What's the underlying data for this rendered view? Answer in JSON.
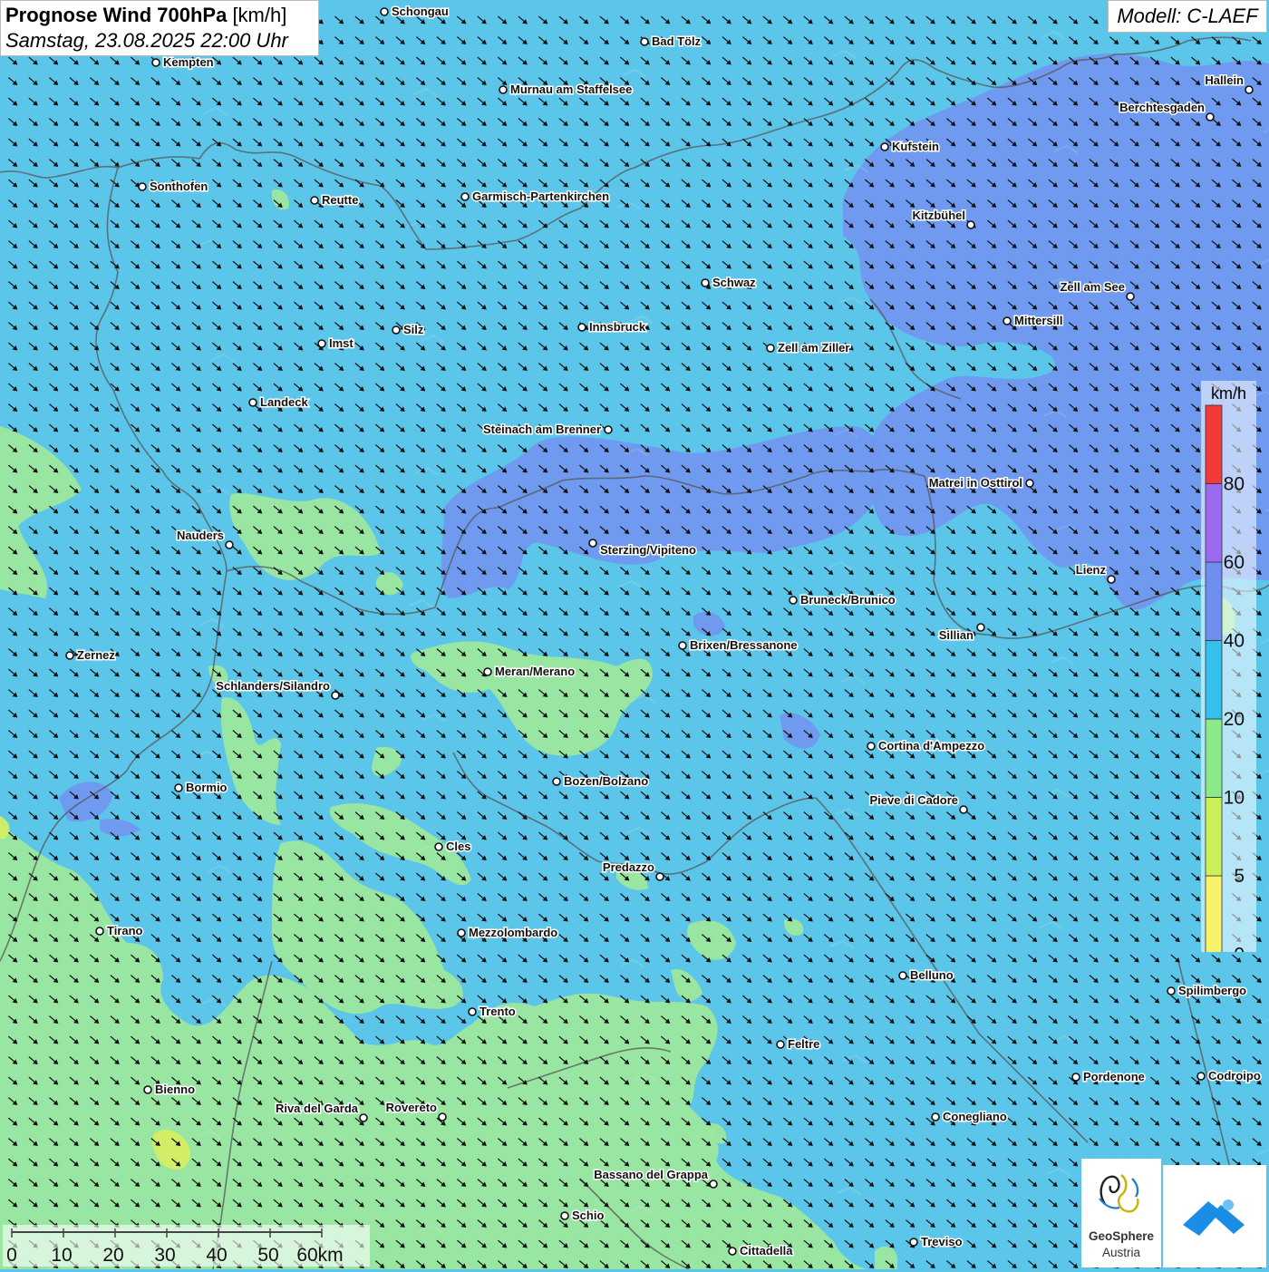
{
  "header": {
    "title_bold": "Prognose Wind 700hPa",
    "title_unit": "[km/h]",
    "datetime": "Samstag, 23.08.2025 22:00 Uhr",
    "model": "Modell: C-LAEF"
  },
  "map_colors": {
    "wind_20_40": "#5cc6ea",
    "wind_10_20": "#9ee79b",
    "wind_40_60": "#7196ef",
    "wind_5_10": "#d7ef62",
    "border": "#555555",
    "arrow": "#111111"
  },
  "places": [
    {
      "name": "Schongau"
    },
    {
      "name": "Bad Tölz"
    },
    {
      "name": "Kempten"
    },
    {
      "name": "Murnau am Staffelsee"
    },
    {
      "name": "Hallein"
    },
    {
      "name": "Berchtesgaden"
    },
    {
      "name": "Kufstein"
    },
    {
      "name": "Sonthofen"
    },
    {
      "name": "Reutte"
    },
    {
      "name": "Garmisch-Partenkirchen"
    },
    {
      "name": "Kitzbühel"
    },
    {
      "name": "Schwaz"
    },
    {
      "name": "Zell am See"
    },
    {
      "name": "Mittersill"
    },
    {
      "name": "Silz"
    },
    {
      "name": "Innsbruck"
    },
    {
      "name": "Imst"
    },
    {
      "name": "Zell am Ziller"
    },
    {
      "name": "Landeck"
    },
    {
      "name": "Steinach am Brenner"
    },
    {
      "name": "Matrei in Osttirol"
    },
    {
      "name": "Nauders"
    },
    {
      "name": "Sterzing/Vipiteno"
    },
    {
      "name": "Lienz"
    },
    {
      "name": "Bruneck/Brunico"
    },
    {
      "name": "Sillian"
    },
    {
      "name": "Brixen/Bressanone"
    },
    {
      "name": "Zernez"
    },
    {
      "name": "Meran/Merano"
    },
    {
      "name": "Schlanders/Silandro"
    },
    {
      "name": "Cortina d'Ampezzo"
    },
    {
      "name": "Bozen/Bolzano"
    },
    {
      "name": "Bormio"
    },
    {
      "name": "Pieve di Cadore"
    },
    {
      "name": "Cles"
    },
    {
      "name": "Predazzo"
    },
    {
      "name": "Tirano"
    },
    {
      "name": "Mezzolombardo"
    },
    {
      "name": "Belluno"
    },
    {
      "name": "Spilimbergo"
    },
    {
      "name": "Trento"
    },
    {
      "name": "Feltre"
    },
    {
      "name": "Pordenone"
    },
    {
      "name": "Codroipo"
    },
    {
      "name": "Bienno"
    },
    {
      "name": "Riva del Garda"
    },
    {
      "name": "Rovereto"
    },
    {
      "name": "Conegliano"
    },
    {
      "name": "Bassano del Grappa"
    },
    {
      "name": "Schio"
    },
    {
      "name": "Treviso"
    },
    {
      "name": "Cittadella"
    }
  ],
  "legend": {
    "unit": "km/h",
    "classes": [
      {
        "from": 0,
        "to": 5,
        "color": "#f6f26a"
      },
      {
        "from": 5,
        "to": 10,
        "color": "#cbf05a"
      },
      {
        "from": 10,
        "to": 20,
        "color": "#8ce98a"
      },
      {
        "from": 20,
        "to": 40,
        "color": "#33c0ec"
      },
      {
        "from": 40,
        "to": 60,
        "color": "#6f8ff0"
      },
      {
        "from": 60,
        "to": 80,
        "color": "#9b6af0"
      },
      {
        "from": 80,
        "to": null,
        "color": "#f23a3a"
      }
    ],
    "labels": [
      "0",
      "5",
      "10",
      "20",
      "40",
      "60",
      "80"
    ]
  },
  "scale": {
    "labels": [
      "0",
      "10",
      "20",
      "30",
      "40",
      "50",
      "60km"
    ]
  },
  "logos": {
    "org_line1": "GeoSphere",
    "org_line2": "Austria"
  }
}
